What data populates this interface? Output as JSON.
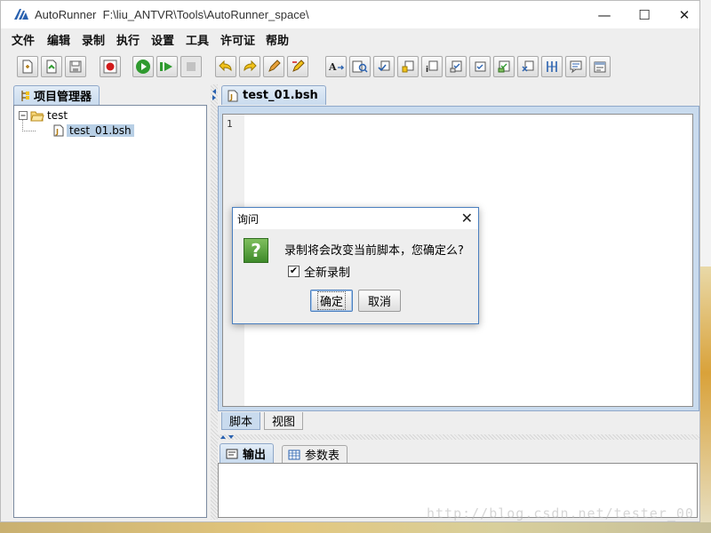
{
  "window": {
    "app_name": "AutoRunner",
    "path": "F:\\liu_ANTVR\\Tools\\AutoRunner_space\\",
    "controls": {
      "minimize": "—",
      "maximize": "☐",
      "close": "✕"
    }
  },
  "menu": [
    "文件",
    "编辑",
    "录制",
    "执行",
    "设置",
    "工具",
    "许可证",
    "帮助"
  ],
  "toolbar_icons": [
    "new-file-icon",
    "open-icon",
    "save-icon",
    "record-icon",
    "run-icon",
    "step-run-icon",
    "stop-icon",
    "undo-icon",
    "redo-icon",
    "pen-icon",
    "edit-pen-icon",
    "text-icon",
    "text-find-icon",
    "checkpoint-icon",
    "checkpoint-2-icon",
    "checkpoint-3-icon",
    "checkpoint-4-icon",
    "checkpoint-5-icon",
    "checkpoint-6-icon",
    "checkpoint-7-icon",
    "spacing-icon",
    "comment-icon",
    "settings-icon"
  ],
  "left_panel": {
    "tab_label": "项目管理器",
    "tree": {
      "root": "test",
      "children": [
        "test_01.bsh"
      ]
    }
  },
  "editor": {
    "tab_label": "test_01.bsh",
    "line_numbers": [
      "1"
    ],
    "bottom_tabs": [
      "脚本",
      "视图"
    ]
  },
  "output_panel": {
    "tabs": [
      "输出",
      "参数表"
    ]
  },
  "dialog": {
    "title": "询问",
    "icon_glyph": "?",
    "message": "录制将会改变当前脚本，您确定么?",
    "checkbox_label": "全新录制",
    "checkbox_checked": true,
    "ok_label": "确定",
    "cancel_label": "取消"
  },
  "watermark": "http://blog.csdn.net/tester_00",
  "colors": {
    "accent": "#4a7fbf",
    "tab_active": "#c9dbee",
    "record_red": "#d11a1a",
    "run_green": "#2f9a2f"
  }
}
